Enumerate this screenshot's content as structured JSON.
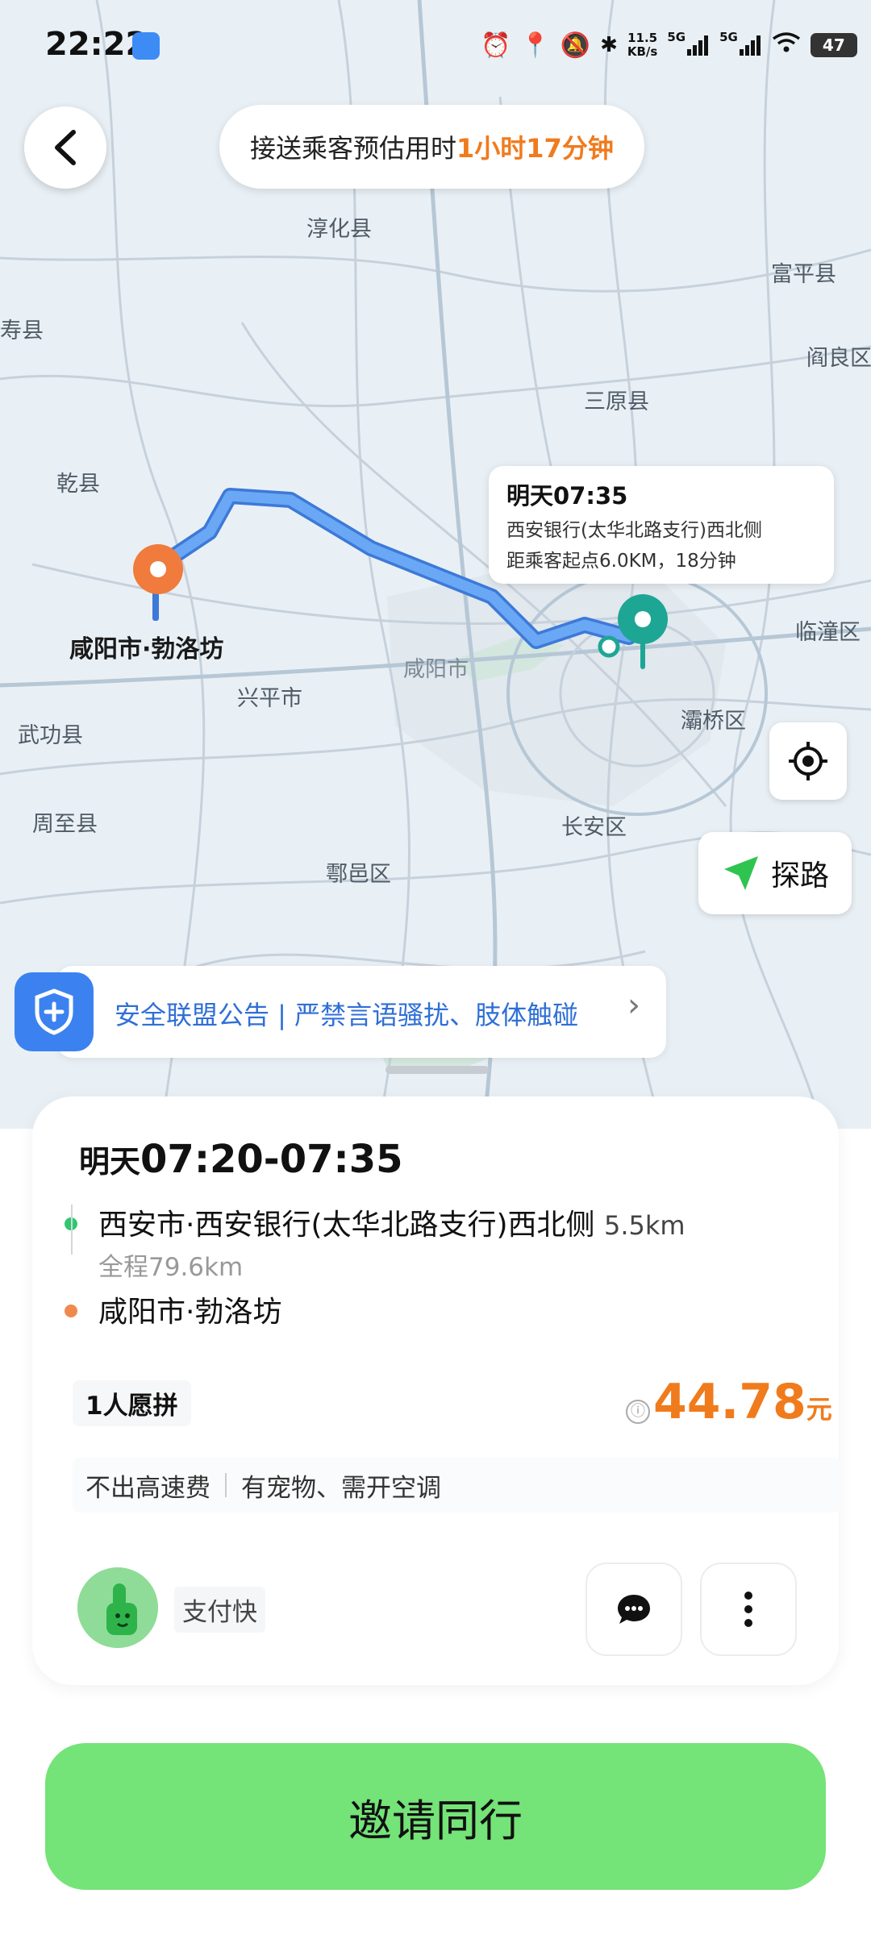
{
  "status_bar": {
    "time": "22:22",
    "net_speed": "11.5",
    "net_speed_unit": "KB/s",
    "network_1": "5G",
    "network_2": "5G",
    "battery": "47",
    "icons": [
      "alarm-icon",
      "location-icon",
      "mute-icon",
      "bluetooth-icon",
      "signal-icon",
      "wifi-icon"
    ]
  },
  "header": {
    "trip_estimate_prefix": "接送乘客预估用时",
    "trip_estimate_value": "1小时17分钟"
  },
  "map": {
    "place_labels": [
      "淳化县",
      "富平县",
      "寿县",
      "阎良区",
      "三原县",
      "乾县",
      "临潼区",
      "咸阳市",
      "兴平市",
      "灞桥区",
      "武功县",
      "周至县",
      "长安区",
      "鄠邑区"
    ],
    "pickup_bubble": {
      "time": "明天07:35",
      "place": "西安银行(太华北路支行)西北侧",
      "distance": "距乘客起点6.0KM，18分钟"
    },
    "destination_label": "咸阳市·勃洛坊",
    "explore_label": "探路",
    "colors": {
      "route": "#5b9bf0",
      "pickup": "#1ea694",
      "destination": "#f07b3c"
    }
  },
  "safety_banner": {
    "text": "安全联盟公告 | 严禁言语骚扰、肢体触碰",
    "chevron": "›"
  },
  "order": {
    "time_prefix": "明天",
    "time_range": "07:20-07:35",
    "from": "西安市·西安银行(太华北路支行)西北侧",
    "from_distance": "5.5km",
    "total_distance": "全程79.6km",
    "to": "咸阳市·勃洛坊",
    "seats": "1人愿拼",
    "price": "44.78",
    "price_unit": "元",
    "price_info_icon": "ⓘ",
    "tags": [
      "不出高速费",
      "有宠物、需开空调"
    ],
    "user_tag": "支付快"
  },
  "invite_button": "邀请同行",
  "accent": {
    "orange": "#f07b1d",
    "green": "#74e378",
    "blue": "#2f6fd6"
  }
}
